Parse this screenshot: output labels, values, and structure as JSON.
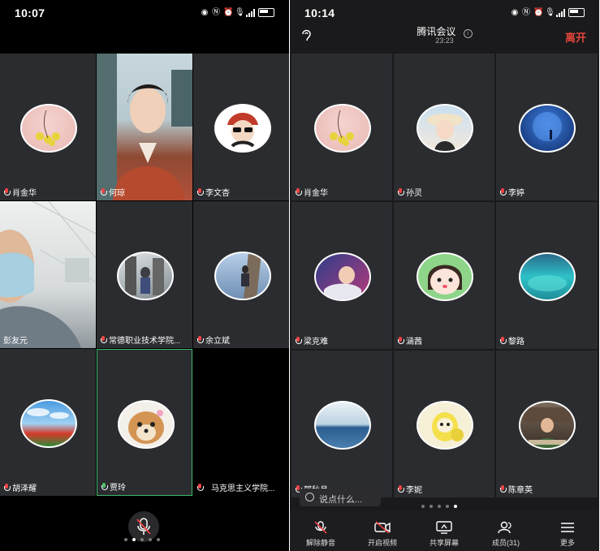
{
  "left": {
    "time": "10:07",
    "tiles": [
      {
        "name": "肖金华"
      },
      {
        "name": "何琼"
      },
      {
        "name": "李文杏"
      },
      {
        "name": "彭友元"
      },
      {
        "name": "常德职业技术学院..."
      },
      {
        "name": "余立斌"
      },
      {
        "name": "胡泽耀"
      },
      {
        "name": "贾玲"
      },
      {
        "name": "马克思主义学院..."
      }
    ],
    "page_dots": 5,
    "active_dot": 1
  },
  "right": {
    "time": "10:14",
    "meeting_title": "腾讯会议",
    "meeting_clock": "23:23",
    "leave_label": "离开",
    "tiles": [
      {
        "name": "肖金华"
      },
      {
        "name": "孙灵"
      },
      {
        "name": "李婷"
      },
      {
        "name": "梁克难"
      },
      {
        "name": "涵茜"
      },
      {
        "name": "黎路"
      },
      {
        "name": "郭秋月"
      },
      {
        "name": "李妮"
      },
      {
        "name": "陈章英"
      }
    ],
    "chat_placeholder": "说点什么...",
    "page_dots": 5,
    "active_dot": 4,
    "toolbar": [
      {
        "label": "解除静音",
        "icon": "mic-muted-icon"
      },
      {
        "label": "开启视频",
        "icon": "camera-off-icon"
      },
      {
        "label": "共享屏幕",
        "icon": "screen-share-icon"
      },
      {
        "label": "成员(31)",
        "icon": "members-icon"
      },
      {
        "label": "更多",
        "icon": "more-menu-icon"
      }
    ]
  },
  "colors": {
    "accent_green": "#4dc36a",
    "leave_red": "#e5453a",
    "tile_bg": "#2b2c30"
  }
}
